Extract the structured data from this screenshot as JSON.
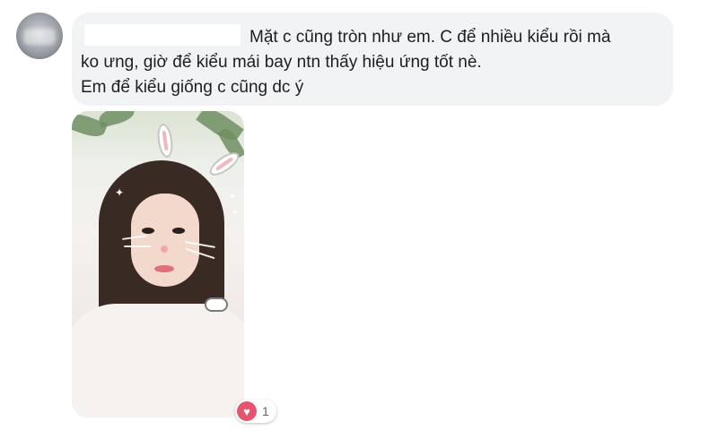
{
  "comment": {
    "text_line1": "Mặt c cũng tròn như em. C để nhiều kiểu rồi mà",
    "text_line2": "ko ưng, giờ để kiểu mái bay ntn thấy hiệu ứng tốt nè.",
    "text_line3": "Em để kiểu giống c cũng dc ý",
    "bubble_color": "#f2f3f5"
  },
  "reaction": {
    "icon": "heart-icon",
    "count": "1",
    "color": "#e4566d"
  }
}
